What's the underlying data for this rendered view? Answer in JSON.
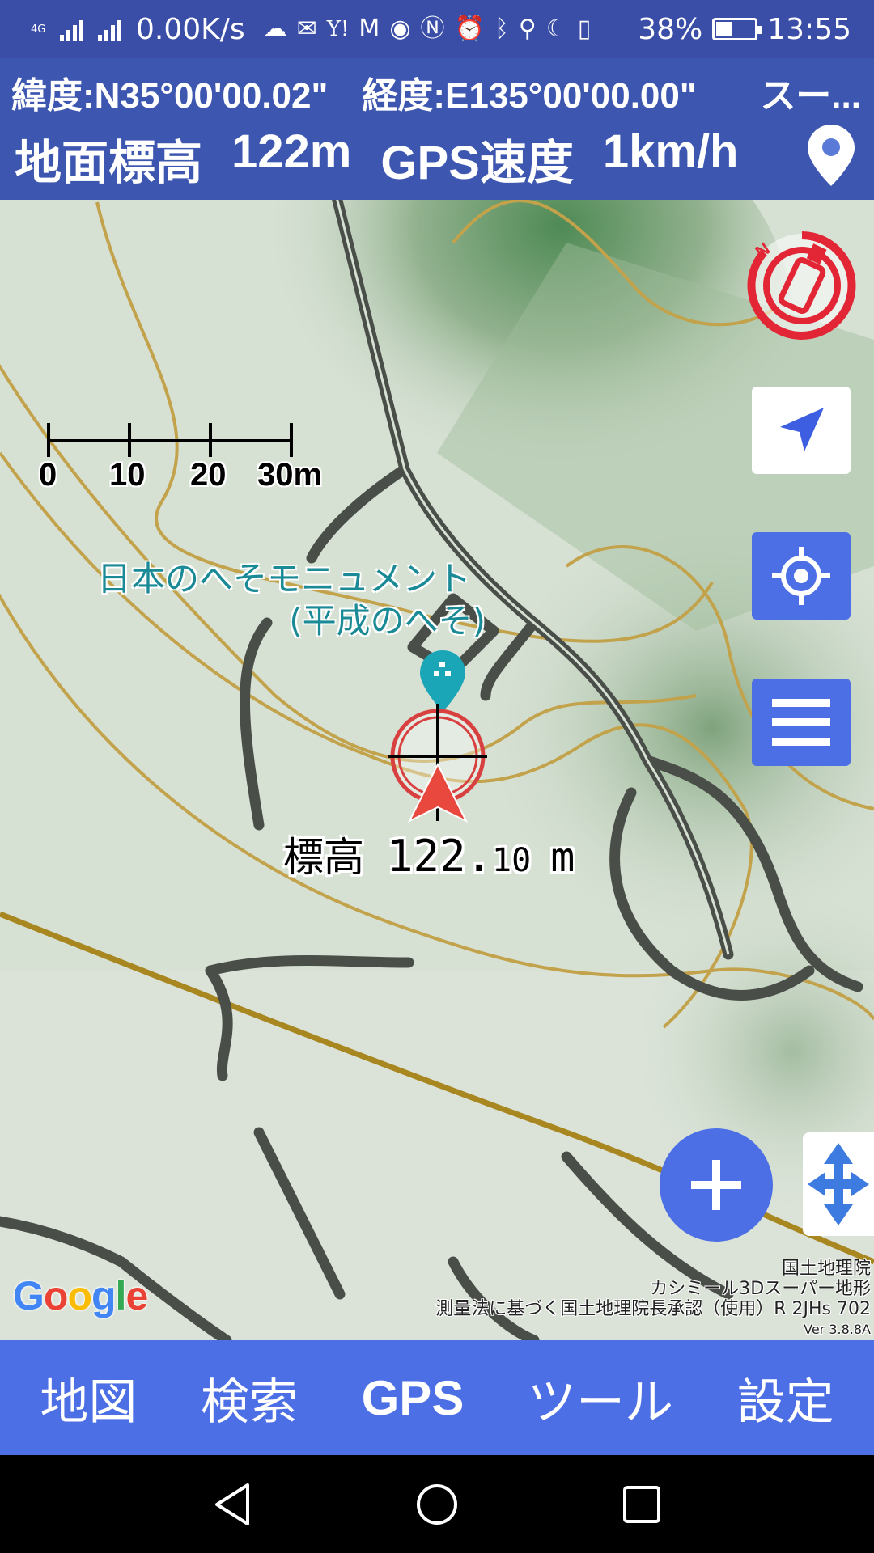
{
  "status_bar": {
    "network_label": "4G",
    "speed": "0.00K/s",
    "icons": [
      "weather-icon",
      "mail-icon",
      "yahoo-icon",
      "gmail-icon",
      "eye-icon",
      "nfc-icon",
      "alarm-icon",
      "bluetooth-icon",
      "location-icon",
      "moon-icon",
      "vibrate-icon"
    ],
    "battery_percent": "38%",
    "battery_level": 0.38,
    "time": "13:55"
  },
  "info_header": {
    "latitude": "緯度:N35°00'00.02\"",
    "longitude": "経度:E135°00'00.00\"",
    "overflow_text": "スー...",
    "ground_elevation_label": "地面標高",
    "ground_elevation_value": "122m",
    "gps_speed_label": "GPS速度",
    "gps_speed_value": "1km/h"
  },
  "map": {
    "scale_labels": [
      "0",
      "10",
      "20",
      "30m"
    ],
    "poi_name_line1": "日本のへそモニュメント",
    "poi_name_line2": "(平成のへそ)",
    "elevation_label": "標高",
    "elevation_int": "122.",
    "elevation_dec": "10",
    "elevation_unit": "m",
    "google_logo": "Google",
    "attribution": [
      "国土地理院",
      "カシミール3Dスーパー地形",
      "測量法に基づく国土地理院長承認（使用）R 2JHs 702"
    ],
    "version": "Ver 3.8.8A"
  },
  "bottom_nav": {
    "tabs": [
      "地図",
      "検索",
      "GPS",
      "ツール",
      "設定"
    ]
  },
  "colors": {
    "accent": "#4c6fe6",
    "status_bar": "#3a4ea8",
    "compass_red": "#e32636",
    "poi_teal": "#1aa6b7"
  }
}
